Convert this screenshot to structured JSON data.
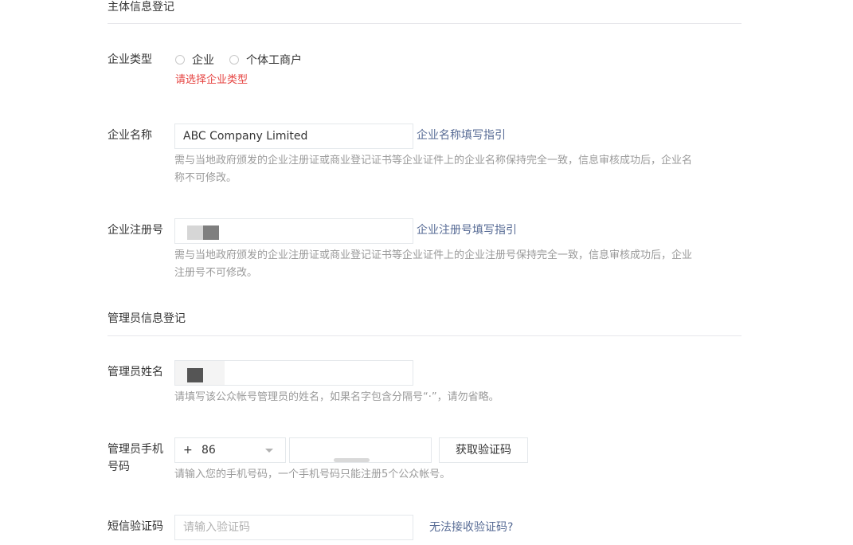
{
  "section_subject": {
    "title": "主体信息登记"
  },
  "enterprise_type": {
    "label": "企业类型",
    "options": [
      "企业",
      "个体工商户"
    ],
    "error": "请选择企业类型"
  },
  "enterprise_name": {
    "label": "企业名称",
    "value": "ABC Company Limited",
    "guide_link": "企业名称填写指引",
    "hint_line1": "需与当地政府颁发的企业注册证或商业登记证书等企业证件上的企业名称保持完全一致，信息审核成功后，企业名",
    "hint_line2": "称不可修改。"
  },
  "registration_number": {
    "label": "企业注册号",
    "guide_link": "企业注册号填写指引",
    "hint_line1": "需与当地政府颁发的企业注册证或商业登记证书等企业证件上的企业注册号保持完全一致，信息审核成功后，企业",
    "hint_line2": "注册号不可修改。"
  },
  "section_admin": {
    "title": "管理员信息登记"
  },
  "admin_name": {
    "label": "管理员姓名",
    "hint": "请填写该公众帐号管理员的姓名，如果名字包含分隔号“·”，请勿省略。"
  },
  "admin_phone": {
    "label_line1": "管理员手机",
    "label_line2": "号码",
    "country_prefix": "+",
    "country_code": "86",
    "get_code_button": "获取验证码",
    "hint": "请输入您的手机号码，一个手机号码只能注册5个公众帐号。"
  },
  "sms_code": {
    "label": "短信验证码",
    "placeholder": "请输入验证码",
    "help_link": "无法接收验证码?"
  }
}
